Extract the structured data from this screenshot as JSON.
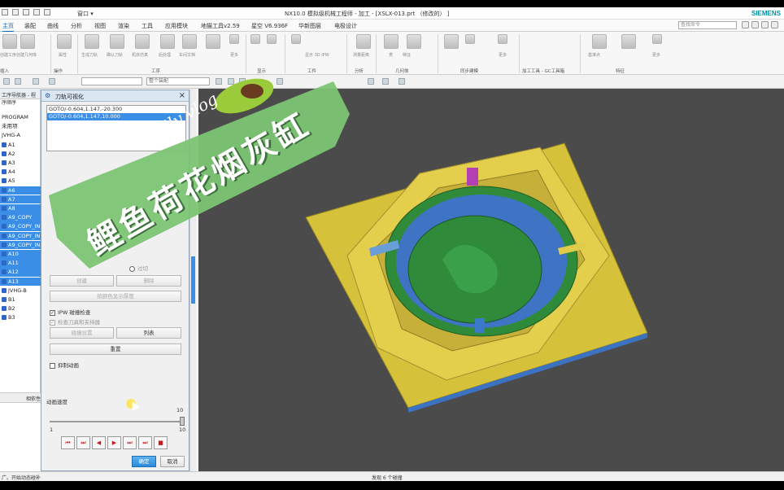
{
  "titlebar": {
    "window_menu": "窗口 ▾",
    "title": "NX10.0 模拟级机械工程师 - 加工 - [XSLX-013.prt （修改的） ]",
    "brand": "SIEMENS"
  },
  "menubar": {
    "tabs": [
      "主页",
      "装配",
      "曲线",
      "分析",
      "视图",
      "渲染",
      "工具",
      "应用模块",
      "地猫工具v2.59",
      "星空 V6.936F",
      "华新图层",
      "电极设计"
    ],
    "search_placeholder": "查找命令"
  },
  "ribbon": {
    "buttons": [
      "创建工序",
      "创建几何体",
      "属性",
      "生成刀轨",
      "确认刀轨",
      "机床仿真",
      "后处理",
      "车间文档",
      "更多",
      "显示 3D IPW",
      "测量距离",
      "类",
      "特征",
      "更多",
      "基准点",
      "更多"
    ],
    "groups": [
      "插入",
      "操作",
      "工序",
      "显示",
      "工件",
      "分析",
      "几何体",
      "同步建模",
      "加工工具 - GC工具箱",
      "特征"
    ]
  },
  "toolbar2": {
    "filter_select": "",
    "assembly_select": "整个装配"
  },
  "navigator": {
    "header": "工序导航器 - 程序顺序",
    "items": [
      {
        "label": "PROGRAM",
        "selected": false
      },
      {
        "label": "未用项",
        "selected": false
      },
      {
        "label": "JVHG-A",
        "selected": false
      },
      {
        "label": "A1",
        "selected": false
      },
      {
        "label": "A2",
        "selected": false
      },
      {
        "label": "A3",
        "selected": false
      },
      {
        "label": "A4",
        "selected": false
      },
      {
        "label": "A5",
        "selected": false
      },
      {
        "label": "A6",
        "selected": true
      },
      {
        "label": "A7",
        "selected": true
      },
      {
        "label": "A8",
        "selected": true
      },
      {
        "label": "A9_COPY",
        "selected": true
      },
      {
        "label": "A9_COPY_IN",
        "selected": true
      },
      {
        "label": "A9_COPY_IN",
        "selected": true
      },
      {
        "label": "A9_COPY_IN",
        "selected": true
      },
      {
        "label": "A10",
        "selected": true
      },
      {
        "label": "A11",
        "selected": true
      },
      {
        "label": "A12",
        "selected": true
      },
      {
        "label": "A13",
        "selected": true
      },
      {
        "label": "JVHG-B",
        "selected": false
      },
      {
        "label": "B1",
        "selected": false
      },
      {
        "label": "B2",
        "selected": false
      },
      {
        "label": "B3",
        "selected": false
      }
    ],
    "dependency_header": "相依性"
  },
  "dialog": {
    "title": "刀轨可视化",
    "goto_lines": [
      "GOTO/-0.604,1.147,-20.300",
      "GOTO/-0.604,1.147,10.000"
    ],
    "radio_partial": "过切",
    "btn_create": "创建",
    "btn_delete": "删除",
    "btn_color": "按颜色显示厚度",
    "chk_ipw": "IPW 碰撞检查",
    "chk_tool_holder": "检查刀具和夹持器",
    "btn_collision_settings": "碰撞设置",
    "btn_list": "列表",
    "btn_reset": "重置",
    "chk_suppress": "抑制动画",
    "anim_speed_label": "动画速度",
    "slider_min": "1",
    "slider_max": "10",
    "slider_value": 10,
    "slider_value_label": "10",
    "player_buttons": [
      "⏮",
      "⏭",
      "◀",
      "▶",
      "⏭",
      "⏭",
      "■"
    ],
    "ok": "确定",
    "cancel": "取消"
  },
  "status": {
    "left": "广。开始动态碰补",
    "center": "发现 6 个碰撞"
  },
  "overlay": {
    "line1": "daily vlog",
    "line2": "鲤鱼荷花烟灰缸"
  },
  "colors": {
    "accent": "#0a64b4",
    "selection": "#3a8ee6",
    "banner_green": "#7cc474",
    "viewport_bg": "#4b4b4b",
    "stock_yellow": "#d8c23c",
    "part_green": "#2f8a3a",
    "part_blue": "#3f74c4"
  }
}
